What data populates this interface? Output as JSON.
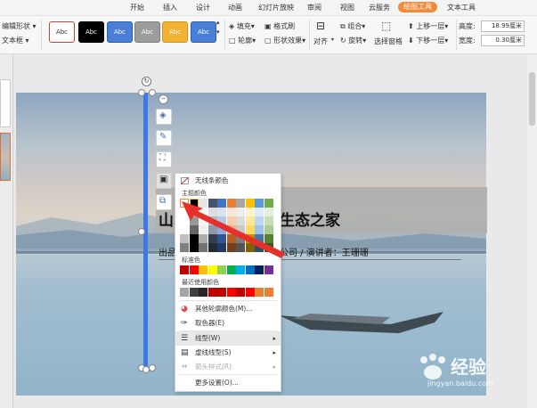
{
  "menubar": {
    "items": [
      "开始",
      "插入",
      "设计",
      "动画",
      "幻灯片放映",
      "审阅",
      "视图",
      "云服务",
      "绘图工具",
      "文本工具"
    ],
    "active": "绘图工具"
  },
  "ribbon": {
    "edit_shape": "编辑形状",
    "text_box": "文本框",
    "styles": [
      "Abc",
      "Abc",
      "Abc",
      "Abc",
      "Abc",
      "Abc"
    ],
    "fill": "填充",
    "format_painter": "格式刷",
    "outline": "轮廓",
    "shape_effects": "形状效果",
    "align": "对齐",
    "group": "组合",
    "rotate": "旋转",
    "selection_pane": "选择窗格",
    "bring_forward": "上移一层",
    "send_backward": "下移一层",
    "height_label": "高度:",
    "height_value": "18.99厘米",
    "width_label": "宽度:",
    "width_value": "0.30厘米"
  },
  "slide": {
    "title_left": "山",
    "title_right": "生态之家",
    "subtitle_left": "出品",
    "subtitle_right": "公司  / 演讲者：王珊珊"
  },
  "dropdown": {
    "no_line": "无线条颜色",
    "theme_colors": "主题颜色",
    "standard_colors": "标准色",
    "recent_colors": "最近使用颜色",
    "more_colors": "其他轮廓颜色(M)...",
    "eyedropper": "取色器(E)",
    "line_type": "线型(W)",
    "dash_type": "虚线线型(S)",
    "arrow_style": "箭头样式(R)",
    "more_settings": "更多设置(O)..."
  },
  "colors": {
    "theme_top": [
      "#ffffff",
      "#000000",
      "#e7e6e6",
      "#44546a",
      "#4472c4",
      "#ed7d31",
      "#a5a5a5",
      "#ffc000",
      "#5b9bd5",
      "#70ad47"
    ],
    "standard": [
      "#c00000",
      "#ff0000",
      "#ffc000",
      "#ffff00",
      "#92d050",
      "#00b050",
      "#00b0f0",
      "#0070c0",
      "#002060",
      "#7030a0"
    ],
    "recent": [
      "#a5a5a5",
      "#404040",
      "#262626",
      "#c00000",
      "#c00000",
      "#ff0000",
      "#c00000",
      "#ff0000",
      "#ed7d31",
      "#ed7d31"
    ],
    "accent": "#f08a3c",
    "selection_blue": "#3c78e6",
    "arrow_red": "#e8302a"
  },
  "watermark": {
    "brand": "经验",
    "site": "jingyan.baidu.com"
  }
}
